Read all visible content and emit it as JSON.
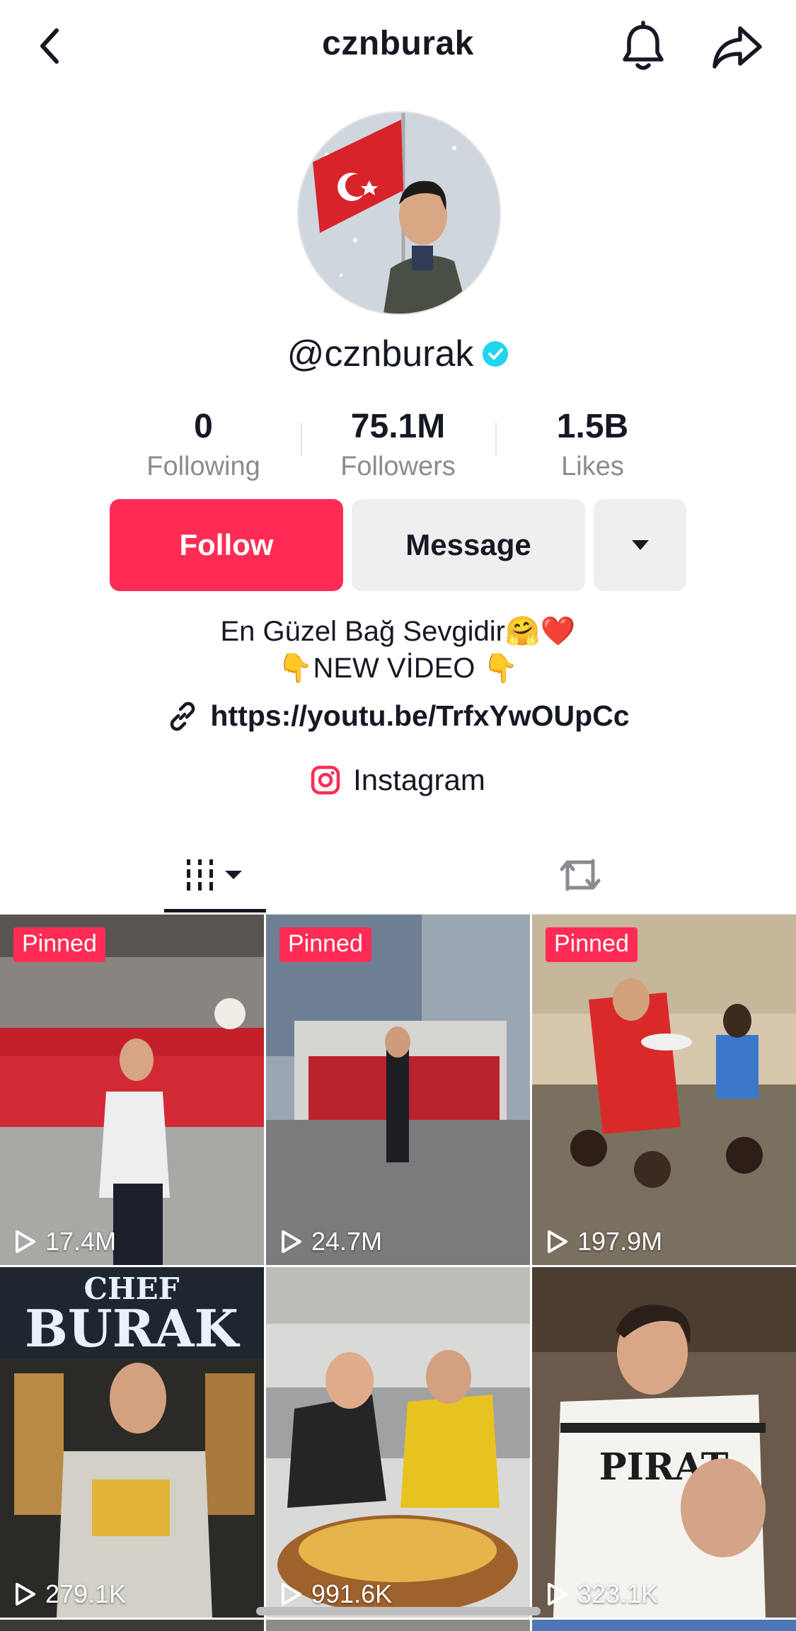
{
  "header": {
    "title": "cznburak",
    "back_icon": "chevron-left-icon",
    "bell_icon": "bell-icon",
    "share_icon": "share-arrow-icon"
  },
  "profile": {
    "handle": "@cznburak",
    "verified": true,
    "stats": [
      {
        "value": "0",
        "label": "Following"
      },
      {
        "value": "75.1M",
        "label": "Followers"
      },
      {
        "value": "1.5B",
        "label": "Likes"
      }
    ],
    "buttons": {
      "follow": "Follow",
      "message": "Message"
    },
    "bio_line1": "En Güzel Bağ Sevgidir🤗❤️",
    "bio_line2": "👇NEW VİDEO 👇",
    "link": "https://youtu.be/TrfxYwOUpCc",
    "instagram": "Instagram"
  },
  "tabs": {
    "videos_icon": "grid-columns-icon",
    "reposts_icon": "repost-icon"
  },
  "videos": [
    {
      "pinned": "Pinned",
      "views": "17.4M"
    },
    {
      "pinned": "Pinned",
      "views": "24.7M"
    },
    {
      "pinned": "Pinned",
      "views": "197.9M"
    },
    {
      "pinned": "",
      "views": "279.1K"
    },
    {
      "pinned": "",
      "views": "991.6K"
    },
    {
      "pinned": "",
      "views": "323.1K"
    }
  ],
  "colors": {
    "accent": "#fe2c55",
    "verified": "#20d5ec",
    "secondary_text": "#8a8b91"
  }
}
